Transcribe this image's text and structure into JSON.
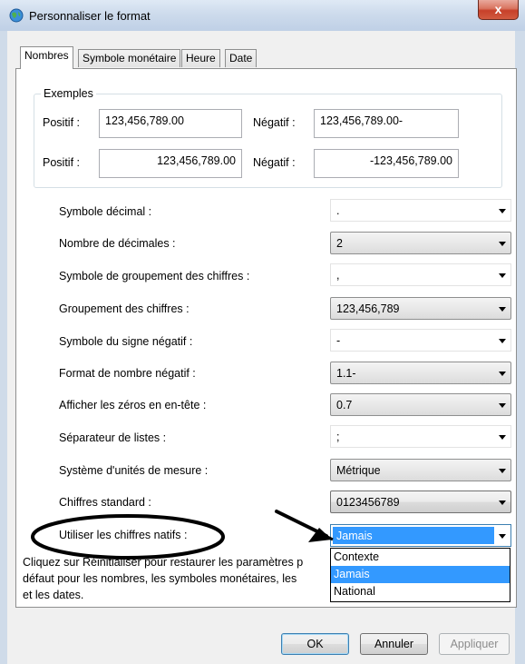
{
  "window": {
    "title": "Personnaliser le format",
    "close_label": "x"
  },
  "tabs": [
    {
      "label": "Nombres",
      "active": true
    },
    {
      "label": "Symbole monétaire"
    },
    {
      "label": "Heure"
    },
    {
      "label": "Date"
    }
  ],
  "examples": {
    "group_label": "Exemples",
    "row1": {
      "pos_label": "Positif :",
      "pos_value": "123,456,789.00",
      "neg_label": "Négatif :",
      "neg_value": "123,456,789.00-"
    },
    "row2": {
      "pos_label": "Positif :",
      "pos_value": "123,456,789.00",
      "neg_label": "Négatif :",
      "neg_value": "-123,456,789.00"
    }
  },
  "settings": [
    {
      "label": "Symbole décimal :",
      "value": "."
    },
    {
      "label": "Nombre de décimales :",
      "value": "2"
    },
    {
      "label": "Symbole de groupement des chiffres :",
      "value": ","
    },
    {
      "label": "Groupement des chiffres :",
      "value": "123,456,789"
    },
    {
      "label": "Symbole du signe négatif :",
      "value": "-"
    },
    {
      "label": "Format de nombre négatif :",
      "value": "1.1-"
    },
    {
      "label": "Afficher les zéros en en-tête :",
      "value": "0.7"
    },
    {
      "label": "Séparateur de listes :",
      "value": ";"
    },
    {
      "label": "Système d'unités de mesure :",
      "value": "Métrique"
    },
    {
      "label": "Chiffres standard :",
      "value": "0123456789"
    },
    {
      "label": "Utiliser les chiffres natifs :",
      "value": "Jamais"
    }
  ],
  "dropdown_options": [
    "Contexte",
    "Jamais",
    "National"
  ],
  "footer": {
    "line1": "Cliquez sur Réinitialiser pour restaurer les paramètres p",
    "line2": "défaut pour les nombres, les symboles monétaires, les",
    "line3": "et les dates."
  },
  "buttons": {
    "ok": "OK",
    "cancel": "Annuler",
    "apply": "Appliquer"
  },
  "colors": {
    "selection": "#3399ff",
    "annotation": "#000000"
  }
}
